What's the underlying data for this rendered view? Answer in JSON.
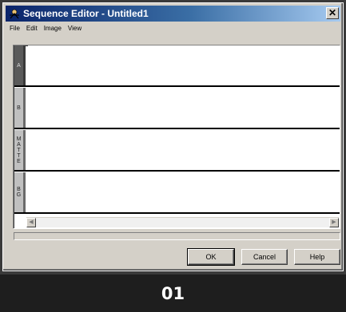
{
  "window": {
    "title": "Sequence Editor - Untitled1",
    "close_glyph": "✕"
  },
  "menu": {
    "items": [
      {
        "label": "File"
      },
      {
        "label": "Edit"
      },
      {
        "label": "Image"
      },
      {
        "label": "View"
      }
    ]
  },
  "tracks": [
    {
      "label": "A",
      "active": true
    },
    {
      "label": "B",
      "active": false
    },
    {
      "label": "M\nA\nT\nT\nE",
      "active": false
    },
    {
      "label": "B\nG",
      "active": false
    }
  ],
  "scrollbar": {
    "left_arrow": "◀",
    "right_arrow": "▶"
  },
  "buttons": {
    "ok": "OK",
    "cancel": "Cancel",
    "help": "Help"
  },
  "caption": {
    "text": "01"
  },
  "colors": {
    "titlebar_start": "#0a246a",
    "titlebar_end": "#a6caf0",
    "window_face": "#d4d0c8",
    "active_track": "#5a5a5a"
  }
}
